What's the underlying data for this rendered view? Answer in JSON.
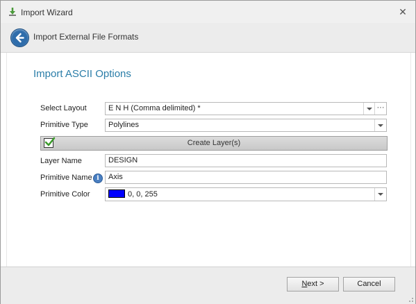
{
  "window": {
    "title": "Import Wizard"
  },
  "header": {
    "title": "Import External File Formats"
  },
  "section": {
    "title": "Import ASCII Options"
  },
  "form": {
    "select_layout": {
      "label": "Select Layout",
      "value": "E N H (Comma delimited) *",
      "more_label": "···"
    },
    "primitive_type": {
      "label": "Primitive Type",
      "value": "Polylines"
    },
    "create_layers": {
      "label": "Create Layer(s)",
      "checked": true
    },
    "layer_name": {
      "label": "Layer Name",
      "value": "DESIGN"
    },
    "primitive_name": {
      "label": "Primitive Name",
      "value": "Axis",
      "info_glyph": "i"
    },
    "primitive_color": {
      "label": "Primitive Color",
      "value": "0, 0, 255",
      "swatch": "#0000ff"
    }
  },
  "footer": {
    "next_label": "Next >",
    "next_mnemonic": "N",
    "next_rest": "ext >",
    "cancel_label": "Cancel"
  },
  "colors": {
    "accent": "#2a7da8",
    "back_button": "#2f6dab"
  },
  "icons": {
    "title": "import-wizard-icon",
    "back": "back-arrow-icon",
    "close": "close-icon",
    "info": "info-icon",
    "check": "checkbox-checked-icon"
  }
}
